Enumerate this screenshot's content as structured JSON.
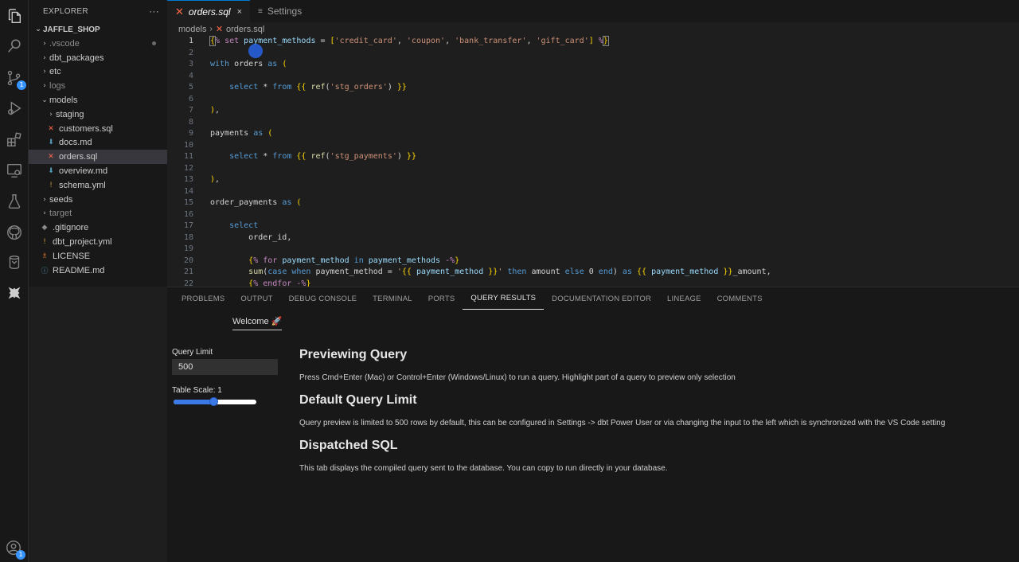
{
  "activity_bar": {
    "items": [
      "files-icon",
      "search-icon",
      "source-control-icon",
      "run-debug-icon",
      "extensions-icon",
      "remote-explorer-icon",
      "testing-icon",
      "github-icon",
      "database-icon",
      "dbt-icon"
    ],
    "source_control_badge": "1",
    "account_badge": "1"
  },
  "sidebar": {
    "title": "EXPLORER",
    "more": "···",
    "root": "JAFFLE_SHOP",
    "items": [
      {
        "label": ".vscode",
        "type": "folder"
      },
      {
        "label": "dbt_packages",
        "type": "folder"
      },
      {
        "label": "etc",
        "type": "folder"
      },
      {
        "label": "logs",
        "type": "folder"
      },
      {
        "label": "models",
        "type": "folder"
      },
      {
        "label": "staging",
        "type": "folder"
      },
      {
        "label": "customers.sql",
        "type": "file"
      },
      {
        "label": "docs.md",
        "type": "file"
      },
      {
        "label": "orders.sql",
        "type": "file"
      },
      {
        "label": "overview.md",
        "type": "file"
      },
      {
        "label": "schema.yml",
        "type": "file"
      },
      {
        "label": "seeds",
        "type": "folder"
      },
      {
        "label": "target",
        "type": "folder"
      },
      {
        "label": ".gitignore",
        "type": "file"
      },
      {
        "label": "dbt_project.yml",
        "type": "file"
      },
      {
        "label": "LICENSE",
        "type": "file"
      },
      {
        "label": "README.md",
        "type": "file"
      }
    ]
  },
  "tabs": [
    {
      "label": "orders.sql",
      "close": "×"
    },
    {
      "label": "Settings"
    }
  ],
  "breadcrumb": {
    "folder": "models",
    "file": "orders.sql"
  },
  "editor": {
    "line_numbers": [
      "1",
      "2",
      "3",
      "4",
      "5",
      "6",
      "7",
      "8",
      "9",
      "10",
      "11",
      "12",
      "13",
      "14",
      "15",
      "16",
      "17",
      "18",
      "19",
      "20",
      "21",
      "22"
    ]
  },
  "panel": {
    "tabs": [
      "PROBLEMS",
      "OUTPUT",
      "DEBUG CONSOLE",
      "TERMINAL",
      "PORTS",
      "QUERY RESULTS",
      "DOCUMENTATION EDITOR",
      "LINEAGE",
      "COMMENTS"
    ],
    "active_tab": "QUERY RESULTS",
    "welcome": "Welcome 🚀",
    "query_limit_label": "Query Limit",
    "query_limit_value": "500",
    "table_scale_label": "Table Scale: 1",
    "table_scale_fraction": 0.48,
    "sections": [
      {
        "heading": "Previewing Query",
        "text": "Press Cmd+Enter (Mac) or Control+Enter (Windows/Linux) to run a query. Highlight part of a query to preview only selection"
      },
      {
        "heading": "Default Query Limit",
        "text": "Query preview is limited to 500 rows by default, this can be configured in Settings -> dbt Power User or via changing the input to the left which is synchronized with the VS Code setting"
      },
      {
        "heading": "Dispatched SQL",
        "text": "This tab displays the compiled query sent to the database. You can copy to run directly in your database."
      }
    ]
  },
  "colors": {
    "accent": "#0078d4",
    "dbt_orange": "#ff694b",
    "badge": "#3794ff"
  }
}
